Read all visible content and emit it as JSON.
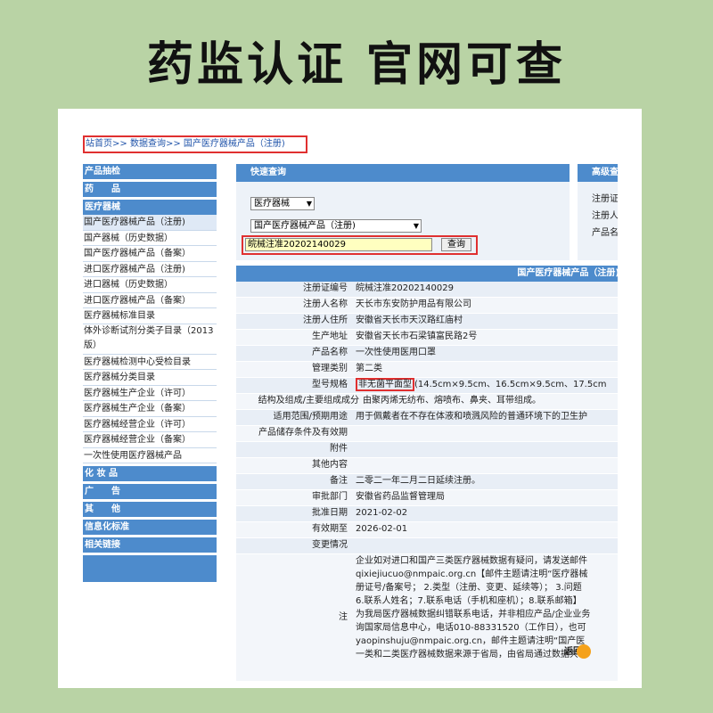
{
  "headline": "药监认证  官网可查",
  "breadcrumb": {
    "home": "站首页",
    "query": "数据查询",
    "current": "国产医疗器械产品（注册)",
    "sep": ">>"
  },
  "sidebar": {
    "sections": [
      {
        "title": "产品抽检",
        "items": []
      },
      {
        "title": "药　　品",
        "items": []
      },
      {
        "title": "医疗器械",
        "items": [
          "国产医疗器械产品（注册)",
          "国产器械（历史数据）",
          "国产医疗器械产品（备案）",
          "进口医疗器械产品（注册)",
          "进口器械（历史数据）",
          "进口医疗器械产品（备案）",
          "医疗器械标准目录",
          "体外诊断试剂分类子目录（2013版）",
          "医疗器械检测中心受检目录",
          "医疗器械分类目录",
          "医疗器械生产企业（许可）",
          "医疗器械生产企业（备案）",
          "医疗器械经营企业（许可）",
          "医疗器械经营企业（备案）",
          "一次性使用医疗器械产品"
        ]
      },
      {
        "title": "化 妆 品",
        "items": []
      },
      {
        "title": "广　　告",
        "items": []
      },
      {
        "title": "其　　他",
        "items": []
      },
      {
        "title": "信息化标准",
        "items": []
      },
      {
        "title": "相关链接",
        "items": []
      }
    ]
  },
  "quick_search": {
    "title": "快速查询",
    "category_select": "医疗器械",
    "product_select": "国产医疗器械产品（注册)",
    "input_value": "皖械注准20202140029",
    "button": "查询"
  },
  "advanced": {
    "title": "高级查",
    "lines": [
      "注册证",
      "注册人",
      "产品名"
    ]
  },
  "detail": {
    "title": "国产医疗器械产品（注册)",
    "rows": [
      {
        "label": "注册证编号",
        "value": "皖械注准20202140029"
      },
      {
        "label": "注册人名称",
        "value": "天长市东安防护用品有限公司"
      },
      {
        "label": "注册人住所",
        "value": "安徽省天长市天汉路红庙村"
      },
      {
        "label": "生产地址",
        "value": "安徽省天长市石梁镇富民路2号"
      },
      {
        "label": "产品名称",
        "value": "一次性使用医用口罩"
      },
      {
        "label": "管理类别",
        "value": "第二类"
      },
      {
        "label": "型号规格",
        "value_highlight": "非无菌平面型",
        "value": "(14.5cm×9.5cm、16.5cm×9.5cm、17.5cm"
      },
      {
        "label": "结构及组成/主要组成成分",
        "value": "由聚丙烯无纺布、熔喷布、鼻夹、耳带组成。"
      },
      {
        "label": "适用范围/预期用途",
        "value": "用于佩戴者在不存在体液和喷溅风险的普通环境下的卫生护"
      },
      {
        "label": "产品储存条件及有效期",
        "value": ""
      },
      {
        "label": "附件",
        "value": ""
      },
      {
        "label": "其他内容",
        "value": ""
      },
      {
        "label": "备注",
        "value": "二零二一年二月二日延续注册。"
      },
      {
        "label": "审批部门",
        "value": "安徽省药品监督管理局"
      },
      {
        "label": "批准日期",
        "value": "2021-02-02"
      },
      {
        "label": "有效期至",
        "value": "2026-02-01"
      },
      {
        "label": "变更情况",
        "value": ""
      }
    ],
    "note_label": "注",
    "note_lines": [
      "企业如对进口和国产三类医疗器械数据有疑问，请发送邮件",
      "qixiejiucuo@nmpaic.org.cn【邮件主题请注明“医疗器械",
      "册证号/备案号； 2.类型（注册、变更、延续等）； 3.问题",
      "6.联系人姓名；7.联系电话（手机和座机）；8.联系邮箱】",
      "为我局医疗器械数据纠错联系电话，并非相应产品/企业业务",
      "询国家局信息中心，电话010-88331520（工作日），也可",
      "yaopinshuju@nmpaic.org.cn，邮件主题请注明“国产医",
      "一类和二类医疗器械数据来源于省局，由省局通过数据共享"
    ]
  },
  "back_button": "返回"
}
